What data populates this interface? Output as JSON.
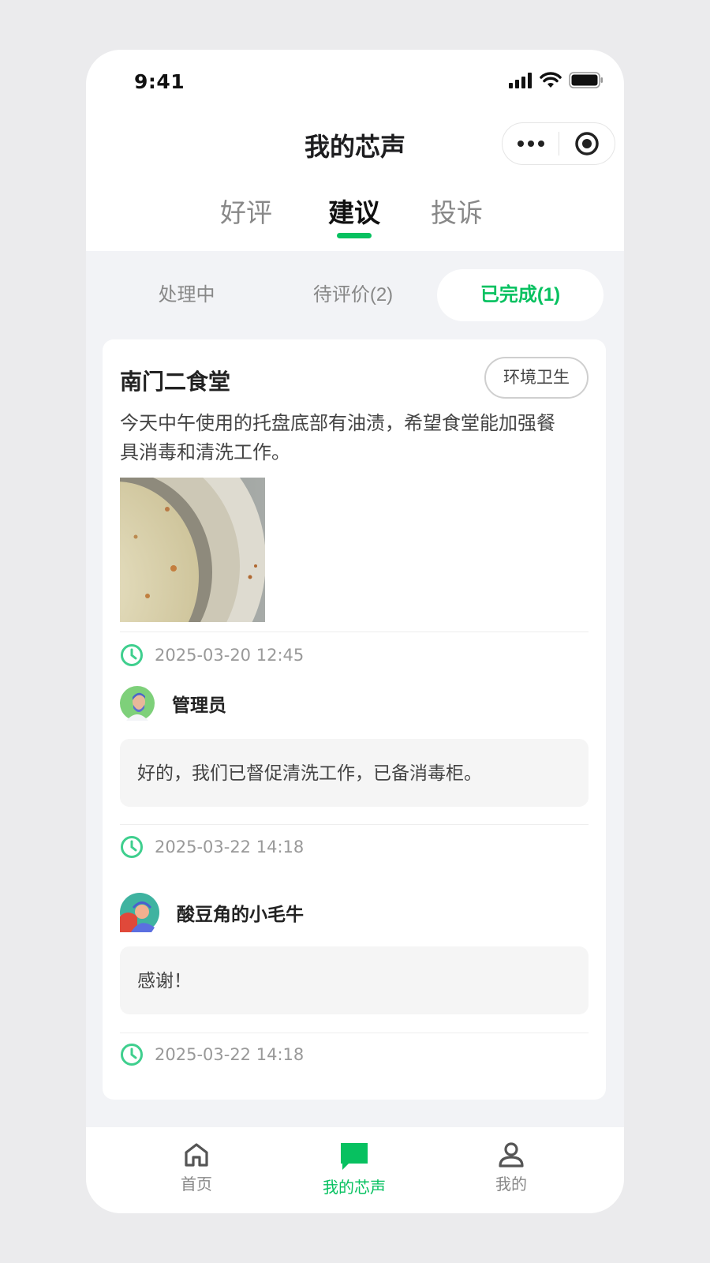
{
  "status_bar": {
    "time": "9:41"
  },
  "header": {
    "title": "我的芯声"
  },
  "tabs": [
    {
      "label": "好评",
      "active": false
    },
    {
      "label": "建议",
      "active": true
    },
    {
      "label": "投诉",
      "active": false
    }
  ],
  "segment": [
    {
      "label": "处理中",
      "active": false
    },
    {
      "label": "待评价(2)",
      "active": false
    },
    {
      "label": "已完成(1)",
      "active": true
    }
  ],
  "card": {
    "store": "南门二食堂",
    "tag": "环境卫生",
    "content": "今天中午使用的托盘底部有油渍，希望食堂能加强餐具消毒和清洗工作。",
    "submitted_time": "2025-03-20 12:45",
    "replies": [
      {
        "user": "管理员",
        "text": "好的，我们已督促清洗工作，已备消毒柜。",
        "time": "2025-03-22 14:18"
      },
      {
        "user": "酸豆角的小毛牛",
        "text": "感谢！",
        "time": "2025-03-22 14:18"
      }
    ]
  },
  "nav": [
    {
      "label": "首页",
      "icon": "home-icon",
      "active": false
    },
    {
      "label": "我的芯声",
      "icon": "chat-icon",
      "active": true
    },
    {
      "label": "我的",
      "icon": "user-icon",
      "active": false
    }
  ],
  "colors": {
    "accent": "#07c160",
    "background": "#f2f3f6"
  }
}
